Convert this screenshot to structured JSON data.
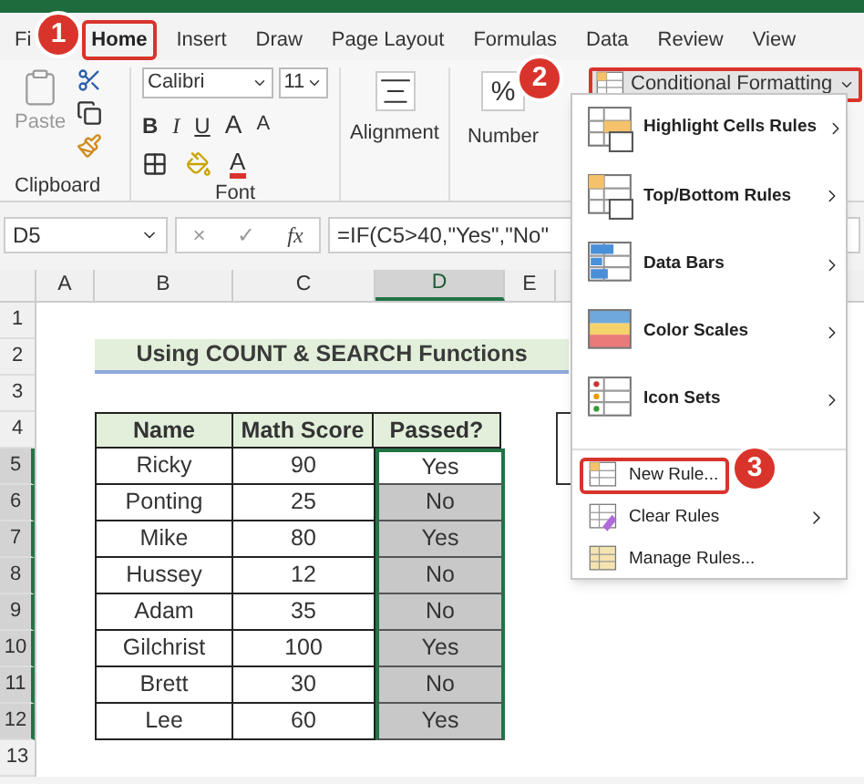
{
  "tabs": [
    {
      "label": "Fi",
      "selected": false
    },
    {
      "label": "Home",
      "selected": true
    },
    {
      "label": "Insert",
      "selected": false
    },
    {
      "label": "Draw",
      "selected": false
    },
    {
      "label": "Page Layout",
      "selected": false
    },
    {
      "label": "Formulas",
      "selected": false
    },
    {
      "label": "Data",
      "selected": false
    },
    {
      "label": "Review",
      "selected": false
    },
    {
      "label": "View",
      "selected": false
    }
  ],
  "ribbon": {
    "clipboard": {
      "paste": "Paste",
      "label": "Clipboard"
    },
    "font": {
      "name": "Calibri",
      "size": "11",
      "bold": "B",
      "italic": "I",
      "underline": "U",
      "grow": "A",
      "shrink": "A",
      "font_color": "A",
      "label": "Font"
    },
    "alignment": "Alignment",
    "number": {
      "symbol": "%",
      "label": "Number"
    },
    "conditional_formatting": "Conditional Formatting"
  },
  "formula_bar": {
    "name_box": "D5",
    "cancel": "×",
    "enter": "✓",
    "fx": "fx",
    "formula": "=IF(C5>40,\"Yes\",\"No\""
  },
  "columns": [
    {
      "label": "A",
      "selected": false
    },
    {
      "label": "B",
      "selected": false
    },
    {
      "label": "C",
      "selected": false
    },
    {
      "label": "D",
      "selected": true
    },
    {
      "label": "E",
      "selected": false
    }
  ],
  "row_numbers": [
    {
      "label": "1",
      "selected": false
    },
    {
      "label": "2",
      "selected": false
    },
    {
      "label": "3",
      "selected": false
    },
    {
      "label": "4",
      "selected": false
    },
    {
      "label": "5",
      "selected": true
    },
    {
      "label": "6",
      "selected": true
    },
    {
      "label": "7",
      "selected": true
    },
    {
      "label": "8",
      "selected": true
    },
    {
      "label": "9",
      "selected": true
    },
    {
      "label": "10",
      "selected": true
    },
    {
      "label": "11",
      "selected": true
    },
    {
      "label": "12",
      "selected": true
    },
    {
      "label": "13",
      "selected": false
    }
  ],
  "title": "Using COUNT & SEARCH Functions",
  "table": {
    "columns": [
      "Name",
      "Math Score",
      "Passed?"
    ],
    "rows": [
      {
        "name": "Ricky",
        "score": "90",
        "passed": "Yes",
        "selected": true,
        "active": true
      },
      {
        "name": "Ponting",
        "score": "25",
        "passed": "No",
        "selected": true,
        "active": false
      },
      {
        "name": "Mike",
        "score": "80",
        "passed": "Yes",
        "selected": true,
        "active": false
      },
      {
        "name": "Hussey",
        "score": "12",
        "passed": "No",
        "selected": true,
        "active": false
      },
      {
        "name": "Adam",
        "score": "35",
        "passed": "No",
        "selected": true,
        "active": false
      },
      {
        "name": "Gilchrist",
        "score": "100",
        "passed": "Yes",
        "selected": true,
        "active": false
      },
      {
        "name": "Brett",
        "score": "30",
        "passed": "No",
        "selected": true,
        "active": false
      },
      {
        "name": "Lee",
        "score": "60",
        "passed": "Yes",
        "selected": true,
        "active": false
      }
    ]
  },
  "menu": {
    "items": [
      {
        "kind": "highlight",
        "label": "Highlight Cells Rules",
        "submenu": true
      },
      {
        "kind": "topbottom",
        "label": "Top/Bottom Rules",
        "submenu": true
      },
      {
        "kind": "databars",
        "label": "Data Bars",
        "submenu": true
      },
      {
        "kind": "colorscales",
        "label": "Color Scales",
        "submenu": true
      },
      {
        "kind": "iconsets",
        "label": "Icon Sets",
        "submenu": true
      }
    ],
    "small_items": [
      {
        "kind": "new",
        "label": "New Rule...",
        "submenu": false,
        "highlighted": true
      },
      {
        "kind": "clear",
        "label": "Clear Rules",
        "submenu": true,
        "highlighted": false
      },
      {
        "kind": "manage",
        "label": "Manage Rules...",
        "submenu": false,
        "highlighted": false
      }
    ]
  },
  "badges": [
    "1",
    "2",
    "3"
  ]
}
